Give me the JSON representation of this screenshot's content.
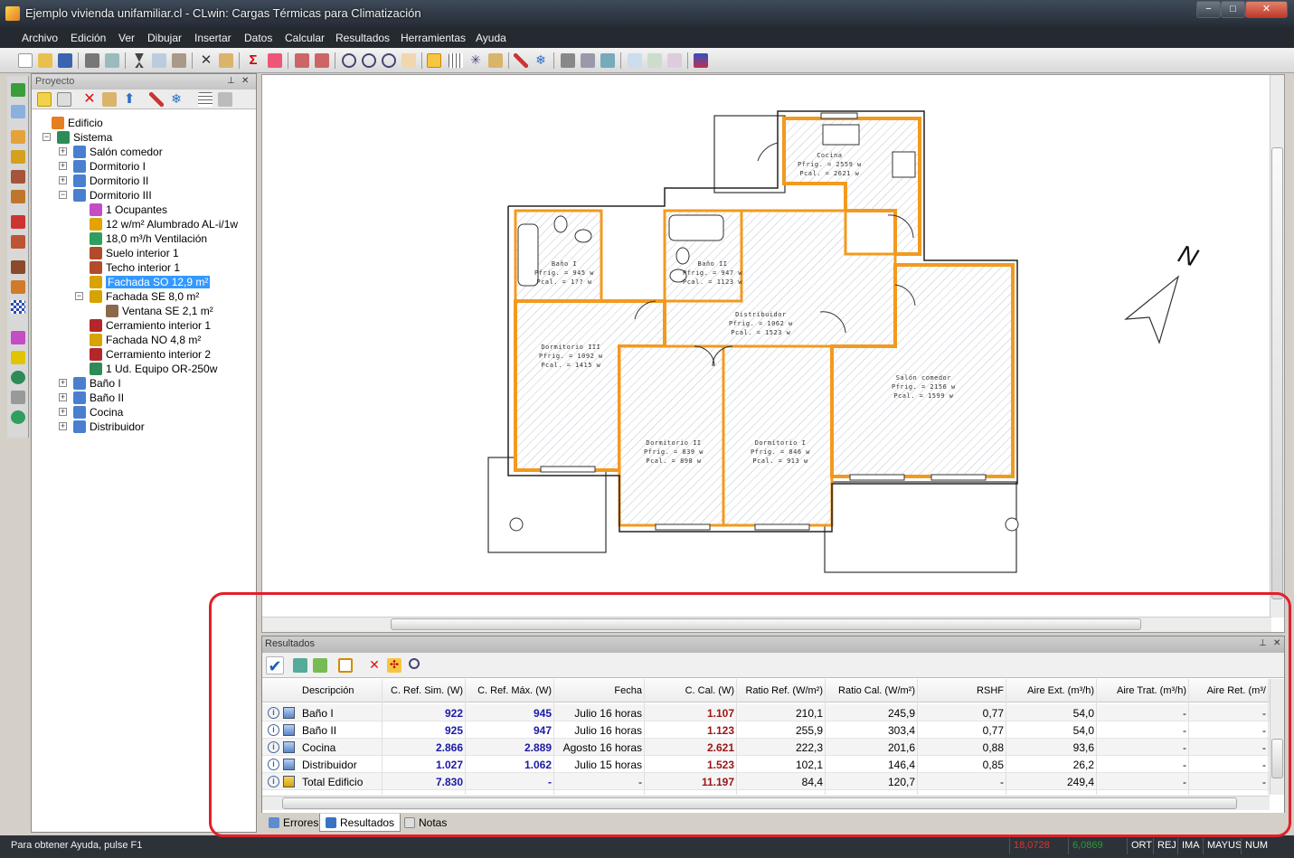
{
  "window": {
    "title": "Ejemplo vivienda unifamiliar.cl - CLwin: Cargas Térmicas para Climatización",
    "min": "−",
    "max": "□",
    "close": "✕"
  },
  "menu": [
    "Archivo",
    "Edición",
    "Ver",
    "Dibujar",
    "Insertar",
    "Datos",
    "Calcular",
    "Resultados",
    "Herramientas",
    "Ayuda"
  ],
  "project_panel": {
    "title": "Proyecto",
    "pin": "📌",
    "close": "✕",
    "tree": [
      {
        "label": "Edificio",
        "level": 0,
        "icon": "building-icon",
        "color": "#e67e22"
      },
      {
        "label": "Sistema",
        "level": 1,
        "icon": "system-icon",
        "color": "#2e8b57",
        "exp": "−"
      },
      {
        "label": "Salón comedor",
        "level": 2,
        "icon": "room-icon",
        "color": "#4a7fd0",
        "exp": "+"
      },
      {
        "label": "Dormitorio I",
        "level": 2,
        "icon": "room-icon",
        "color": "#4a7fd0",
        "exp": "+"
      },
      {
        "label": "Dormitorio II",
        "level": 2,
        "icon": "room-icon",
        "color": "#4a7fd0",
        "exp": "+"
      },
      {
        "label": "Dormitorio III",
        "level": 2,
        "icon": "room-icon",
        "color": "#4a7fd0",
        "exp": "−"
      },
      {
        "label": "1 Ocupantes",
        "level": 3,
        "icon": "occupants-icon",
        "color": "#c44cc4"
      },
      {
        "label": "12 w/m² Alumbrado AL-i/1w",
        "level": 3,
        "icon": "lighting-icon",
        "color": "#e1a400"
      },
      {
        "label": "18,0 m³/h Ventilación",
        "level": 3,
        "icon": "ventilation-icon",
        "color": "#2f9e5f"
      },
      {
        "label": "Suelo interior 1",
        "level": 3,
        "icon": "floor-icon",
        "color": "#b34a2a"
      },
      {
        "label": "Techo interior 1",
        "level": 3,
        "icon": "ceiling-icon",
        "color": "#b34a2a"
      },
      {
        "label": "Fachada SO 12,9 m²",
        "level": 3,
        "icon": "facade-icon",
        "color": "#d6a300",
        "selected": true
      },
      {
        "label": "Fachada SE 8,0 m²",
        "level": 3,
        "icon": "facade-icon",
        "color": "#d6a300",
        "exp": "−"
      },
      {
        "label": "Ventana SE 2,1 m²",
        "level": 4,
        "icon": "window-icon",
        "color": "#8a6a4a"
      },
      {
        "label": "Cerramiento interior 1",
        "level": 3,
        "icon": "wall-icon",
        "color": "#b3262a"
      },
      {
        "label": "Fachada NO 4,8 m²",
        "level": 3,
        "icon": "facade-icon",
        "color": "#d6a300"
      },
      {
        "label": "Cerramiento interior 2",
        "level": 3,
        "icon": "wall-icon",
        "color": "#b3262a"
      },
      {
        "label": "1 Ud. Equipo OR-250w",
        "level": 3,
        "icon": "equipment-icon",
        "color": "#2e8b57"
      },
      {
        "label": "Baño I",
        "level": 2,
        "icon": "room-icon",
        "color": "#4a7fd0",
        "exp": "+"
      },
      {
        "label": "Baño II",
        "level": 2,
        "icon": "room-icon",
        "color": "#4a7fd0",
        "exp": "+"
      },
      {
        "label": "Cocina",
        "level": 2,
        "icon": "room-icon",
        "color": "#4a7fd0",
        "exp": "+"
      },
      {
        "label": "Distribuidor",
        "level": 2,
        "icon": "room-icon",
        "color": "#4a7fd0",
        "exp": "+"
      }
    ]
  },
  "plan": {
    "rooms": [
      {
        "name": "Cocina",
        "l1": "Pfrig. = 2559 w",
        "l2": "Pcal. = 2621 w"
      },
      {
        "name": "Baño I",
        "l1": "Pfrig. = 945 w",
        "l2": "Pcal. = 1?? w"
      },
      {
        "name": "Baño II",
        "l1": "Pfrig. = 947 w",
        "l2": "Pcal. = 1123 w"
      },
      {
        "name": "Distribuidor",
        "l1": "Pfrig. = 1062 w",
        "l2": "Pcal. = 1523 w"
      },
      {
        "name": "Dormitorio III",
        "l1": "Pfrig. = 1092 w",
        "l2": "Pcal. = 1415 w"
      },
      {
        "name": "Dormitorio II",
        "l1": "Pfrig. = 839 w",
        "l2": "Pcal. = 898 w"
      },
      {
        "name": "Dormitorio I",
        "l1": "Pfrig. = 846 w",
        "l2": "Pcal. = 913 w"
      },
      {
        "name": "Salón comedor",
        "l1": "Pfrig. = 2156 w",
        "l2": "Pcal. = 1599 w"
      }
    ],
    "north": "N"
  },
  "results_panel": {
    "title": "Resultados",
    "columns": [
      "Descripción",
      "C. Ref. Sim. (W)",
      "C. Ref. Máx. (W)",
      "Fecha",
      "C. Cal. (W)",
      "Ratio Ref. (W/m²)",
      "Ratio Cal. (W/m²)",
      "RSHF",
      "Aire Ext. (m³/h)",
      "Aire Trat. (m³/h)",
      "Aire Ret. (m³/"
    ],
    "rows": [
      [
        "Baño I",
        "922",
        "945",
        "Julio 16 horas",
        "1.107",
        "210,1",
        "245,9",
        "0,77",
        "54,0",
        "-",
        "-"
      ],
      [
        "Baño II",
        "925",
        "947",
        "Julio 16 horas",
        "1.123",
        "255,9",
        "303,4",
        "0,77",
        "54,0",
        "-",
        "-"
      ],
      [
        "Cocina",
        "2.866",
        "2.889",
        "Agosto 16 horas",
        "2.621",
        "222,3",
        "201,6",
        "0,88",
        "93,6",
        "-",
        "-"
      ],
      [
        "Distribuidor",
        "1.027",
        "1.062",
        "Julio 15 horas",
        "1.523",
        "102,1",
        "146,4",
        "0,85",
        "26,2",
        "-",
        "-"
      ],
      [
        "Total Edificio",
        "7.830",
        "-",
        "-",
        "11.197",
        "84,4",
        "120,7",
        "-",
        "249,4",
        "-",
        "-"
      ]
    ],
    "tabs": [
      "Errores",
      "Resultados",
      "Notas"
    ]
  },
  "statusbar": {
    "help": "Para obtener Ayuda, pulse F1",
    "coord_x": "18,0728",
    "coord_y": "6,0869",
    "flags": [
      "ORT",
      "REJ",
      "IMA",
      "MAYUS",
      "NUM"
    ]
  },
  "colors": {
    "accent": "#e0202a",
    "wall": "#f29a1f",
    "blue_value": "#1a1aa6",
    "red_value": "#9b1414"
  }
}
